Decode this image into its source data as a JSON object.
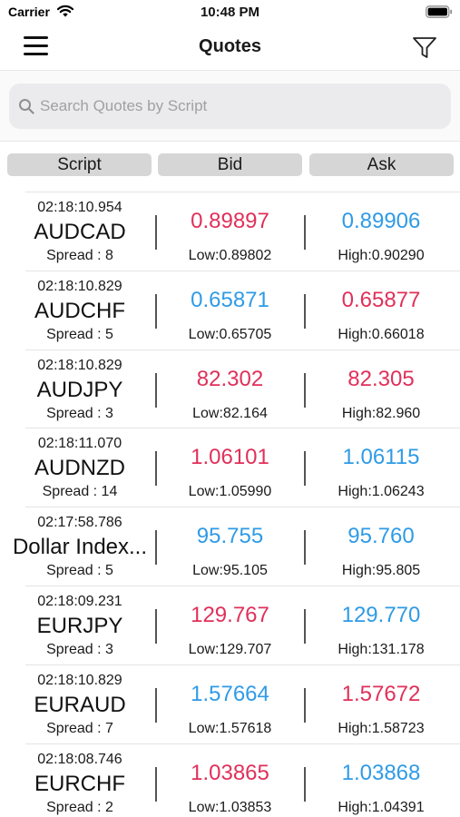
{
  "status_bar": {
    "carrier": "Carrier",
    "time": "10:48 PM"
  },
  "nav": {
    "title": "Quotes"
  },
  "search": {
    "placeholder": "Search Quotes by Script"
  },
  "headers": {
    "script": "Script",
    "bid": "Bid",
    "ask": "Ask"
  },
  "colors": {
    "down": "#e0305a",
    "up": "#2f9be6"
  },
  "quotes": [
    {
      "time": "02:18:10.954",
      "symbol": "AUDCAD",
      "spread": "Spread : 8",
      "bid": "0.89897",
      "bid_dir": "down",
      "low": "Low:0.89802",
      "ask": "0.89906",
      "ask_dir": "up",
      "high": "High:0.90290"
    },
    {
      "time": "02:18:10.829",
      "symbol": "AUDCHF",
      "spread": "Spread : 5",
      "bid": "0.65871",
      "bid_dir": "up",
      "low": "Low:0.65705",
      "ask": "0.65877",
      "ask_dir": "down",
      "high": "High:0.66018"
    },
    {
      "time": "02:18:10.829",
      "symbol": "AUDJPY",
      "spread": "Spread : 3",
      "bid": "82.302",
      "bid_dir": "down",
      "low": "Low:82.164",
      "ask": "82.305",
      "ask_dir": "down",
      "high": "High:82.960"
    },
    {
      "time": "02:18:11.070",
      "symbol": "AUDNZD",
      "spread": "Spread : 14",
      "bid": "1.06101",
      "bid_dir": "down",
      "low": "Low:1.05990",
      "ask": "1.06115",
      "ask_dir": "up",
      "high": "High:1.06243"
    },
    {
      "time": "02:17:58.786",
      "symbol": "Dollar Index...",
      "spread": "Spread : 5",
      "bid": "95.755",
      "bid_dir": "up",
      "low": "Low:95.105",
      "ask": "95.760",
      "ask_dir": "up",
      "high": "High:95.805"
    },
    {
      "time": "02:18:09.231",
      "symbol": "EURJPY",
      "spread": "Spread : 3",
      "bid": "129.767",
      "bid_dir": "down",
      "low": "Low:129.707",
      "ask": "129.770",
      "ask_dir": "up",
      "high": "High:131.178"
    },
    {
      "time": "02:18:10.829",
      "symbol": "EURAUD",
      "spread": "Spread : 7",
      "bid": "1.57664",
      "bid_dir": "up",
      "low": "Low:1.57618",
      "ask": "1.57672",
      "ask_dir": "down",
      "high": "High:1.58723"
    },
    {
      "time": "02:18:08.746",
      "symbol": "EURCHF",
      "spread": "Spread : 2",
      "bid": "1.03865",
      "bid_dir": "down",
      "low": "Low:1.03853",
      "ask": "1.03868",
      "ask_dir": "up",
      "high": "High:1.04391"
    }
  ]
}
